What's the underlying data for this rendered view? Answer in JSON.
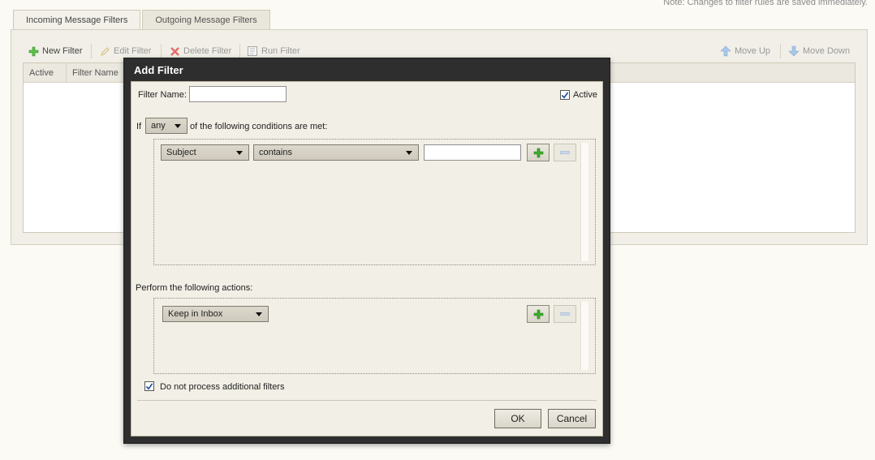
{
  "note": "Note: Changes to filter rules are saved immediately.",
  "tabs": [
    {
      "label": "Incoming Message Filters",
      "active": true
    },
    {
      "label": "Outgoing Message Filters",
      "active": false
    }
  ],
  "toolbar": {
    "new_filter": "New Filter",
    "edit_filter": "Edit Filter",
    "delete_filter": "Delete Filter",
    "run_filter": "Run Filter",
    "move_up": "Move Up",
    "move_down": "Move Down"
  },
  "grid": {
    "columns": [
      "Active",
      "Filter Name"
    ]
  },
  "dialog": {
    "title": "Add Filter",
    "filter_name_label": "Filter Name:",
    "filter_name_value": "",
    "active_label": "Active",
    "active_checked": true,
    "if_label": "If",
    "match_select": "any",
    "conditions_suffix": "of the following conditions are met:",
    "condition": {
      "field": "Subject",
      "operator": "contains",
      "value": ""
    },
    "actions_label": "Perform the following actions:",
    "action": {
      "type": "Keep in Inbox"
    },
    "stop_processing_label": "Do not process additional filters",
    "stop_processing_checked": true,
    "ok": "OK",
    "cancel": "Cancel"
  },
  "colors": {
    "dialog_frame": "#2e2e2e",
    "dialog_body": "#f2efe6",
    "add_icon_green": "#3dae2b",
    "delete_icon_red": "#e46a6a",
    "move_icon_blue": "#7aa6d8"
  }
}
